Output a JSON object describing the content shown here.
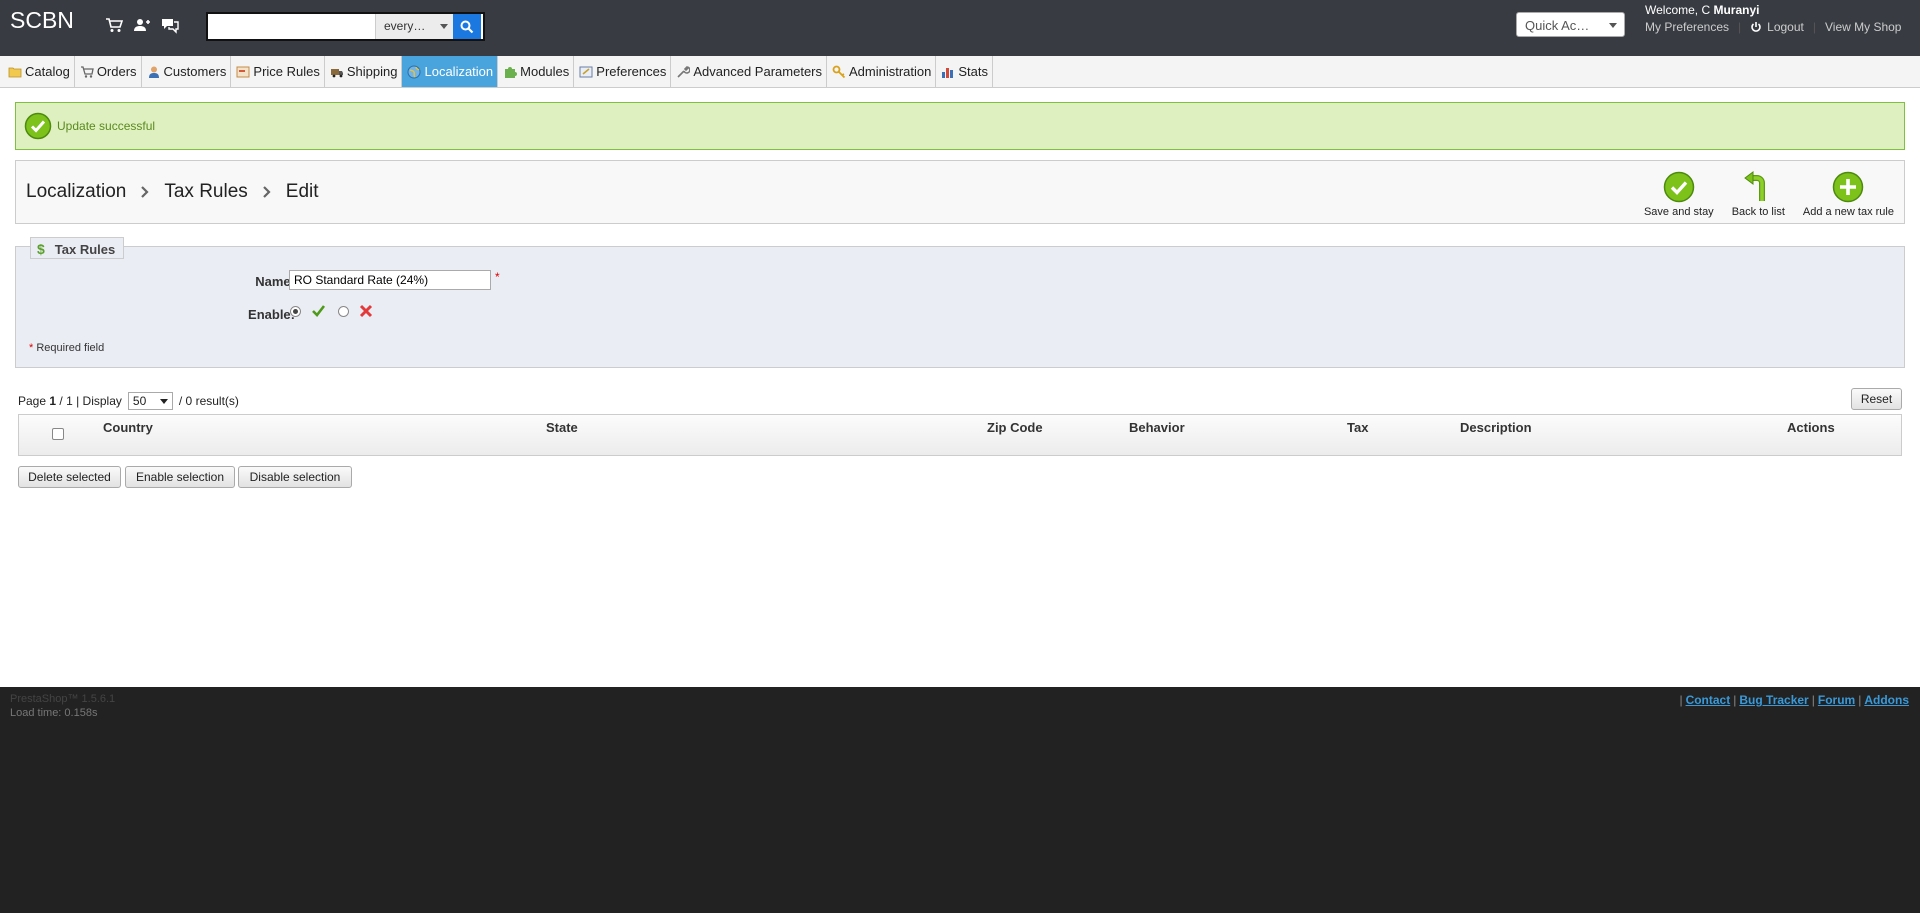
{
  "header": {
    "brand": "SCBN",
    "icons": [
      "cart-icon",
      "customers-icon",
      "messages-icon"
    ],
    "search": {
      "value": "",
      "scope": "every…"
    },
    "quick_access": "Quick Ac…",
    "welcome_prefix": "Welcome, C",
    "welcome_name": "Muranyi",
    "links": {
      "preferences": "My Preferences",
      "logout": "Logout",
      "view_shop": "View My Shop"
    }
  },
  "tabs": [
    {
      "label": "Catalog",
      "icon": "folder-icon"
    },
    {
      "label": "Orders",
      "icon": "cart-icon"
    },
    {
      "label": "Customers",
      "icon": "user-icon"
    },
    {
      "label": "Price Rules",
      "icon": "price-tag-icon"
    },
    {
      "label": "Shipping",
      "icon": "truck-icon"
    },
    {
      "label": "Localization",
      "icon": "globe-icon",
      "active": true
    },
    {
      "label": "Modules",
      "icon": "puzzle-icon"
    },
    {
      "label": "Preferences",
      "icon": "preferences-icon"
    },
    {
      "label": "Advanced Parameters",
      "icon": "wrench-icon"
    },
    {
      "label": "Administration",
      "icon": "key-icon"
    },
    {
      "label": "Stats",
      "icon": "bar-chart-icon"
    }
  ],
  "alert": {
    "message": "Update successful"
  },
  "breadcrumb": [
    "Localization",
    "Tax Rules",
    "Edit"
  ],
  "toolbar": {
    "save_and_stay": "Save and stay",
    "back_to_list": "Back to list",
    "add_new": "Add a new tax rule"
  },
  "form": {
    "legend": "Tax Rules",
    "name_label": "Name:",
    "name_value": "RO Standard Rate (24%)",
    "required_marker": "*",
    "enable_label": "Enable:",
    "enabled": true,
    "required_note": "Required field"
  },
  "list": {
    "page_label": "Page",
    "page_current": "1",
    "page_total": "/ 1",
    "display_label": "| Display",
    "per_page": "50",
    "results": "/ 0 result(s)",
    "reset": "Reset",
    "columns": [
      "Country",
      "State",
      "Zip Code",
      "Behavior",
      "Tax",
      "Description",
      "Actions"
    ],
    "bulk": {
      "delete": "Delete selected",
      "enable": "Enable selection",
      "disable": "Disable selection"
    }
  },
  "footer": {
    "version": "PrestaShop™ 1.5.6.1",
    "load_time": "Load time: 0.158s",
    "links": [
      "Contact",
      "Bug Tracker",
      "Forum",
      "Addons"
    ]
  },
  "colors": {
    "header_bg": "#383c42",
    "active_tab": "#49a3dd",
    "success_bg": "#dff0c0",
    "success_text": "#5a8a1e",
    "accent_green": "#7cc21a",
    "footer_bg": "#222222"
  }
}
